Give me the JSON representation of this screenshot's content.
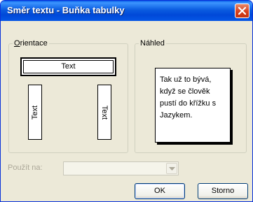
{
  "window": {
    "title": "Směr textu - Buňka tabulky",
    "accent_color": "#0054e3",
    "close_icon": "close-icon"
  },
  "orientation": {
    "label_mnemonic": "O",
    "label_rest": "rientace",
    "options": [
      {
        "label": "Text",
        "direction": "horizontal",
        "selected": true
      },
      {
        "label": "Text",
        "direction": "vertical-bottom-to-top",
        "selected": false
      },
      {
        "label": "Text",
        "direction": "vertical-top-to-bottom",
        "selected": false
      }
    ]
  },
  "preview": {
    "label": "Náhled",
    "lines": [
      "Tak už to bývá,",
      "když se člověk",
      "pustí do křížku s",
      "Jazykem."
    ]
  },
  "apply_to": {
    "label": "Použít na:",
    "value": "",
    "icon": "chevron-down-icon",
    "disabled": true
  },
  "buttons": {
    "ok": "OK",
    "cancel": "Storno"
  }
}
